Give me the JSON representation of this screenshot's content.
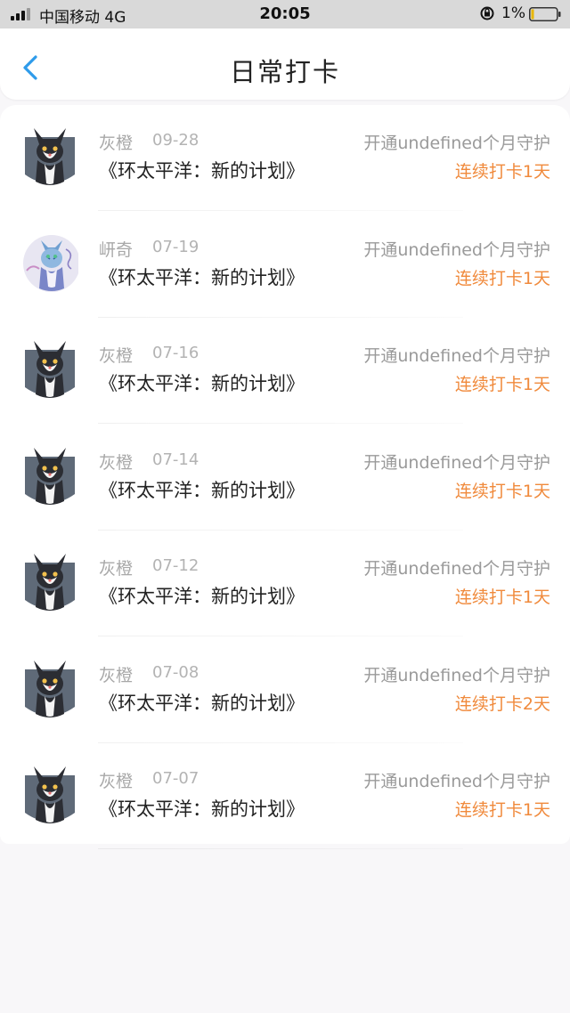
{
  "status_bar": {
    "carrier": "中国移动 4G",
    "time": "20:05",
    "battery": "1%"
  },
  "header": {
    "title": "日常打卡"
  },
  "colors": {
    "accent_blue": "#2e9bea",
    "streak_orange": "#f08a3c"
  },
  "checkins": [
    {
      "user": "灰橙",
      "date": "09-28",
      "gift": "开通undefined个月守护",
      "work": "《环太平洋：新的计划》",
      "streak": "连续打卡1天",
      "avatar": "cat-avatar"
    },
    {
      "user": "岍奇",
      "date": "07-19",
      "gift": "开通undefined个月守护",
      "work": "《环太平洋：新的计划》",
      "streak": "连续打卡1天",
      "avatar": "anime-avatar"
    },
    {
      "user": "灰橙",
      "date": "07-16",
      "gift": "开通undefined个月守护",
      "work": "《环太平洋：新的计划》",
      "streak": "连续打卡1天",
      "avatar": "cat-avatar"
    },
    {
      "user": "灰橙",
      "date": "07-14",
      "gift": "开通undefined个月守护",
      "work": "《环太平洋：新的计划》",
      "streak": "连续打卡1天",
      "avatar": "cat-avatar"
    },
    {
      "user": "灰橙",
      "date": "07-12",
      "gift": "开通undefined个月守护",
      "work": "《环太平洋：新的计划》",
      "streak": "连续打卡1天",
      "avatar": "cat-avatar"
    },
    {
      "user": "灰橙",
      "date": "07-08",
      "gift": "开通undefined个月守护",
      "work": "《环太平洋：新的计划》",
      "streak": "连续打卡2天",
      "avatar": "cat-avatar"
    },
    {
      "user": "灰橙",
      "date": "07-07",
      "gift": "开通undefined个月守护",
      "work": "《环太平洋：新的计划》",
      "streak": "连续打卡1天",
      "avatar": "cat-avatar"
    }
  ]
}
